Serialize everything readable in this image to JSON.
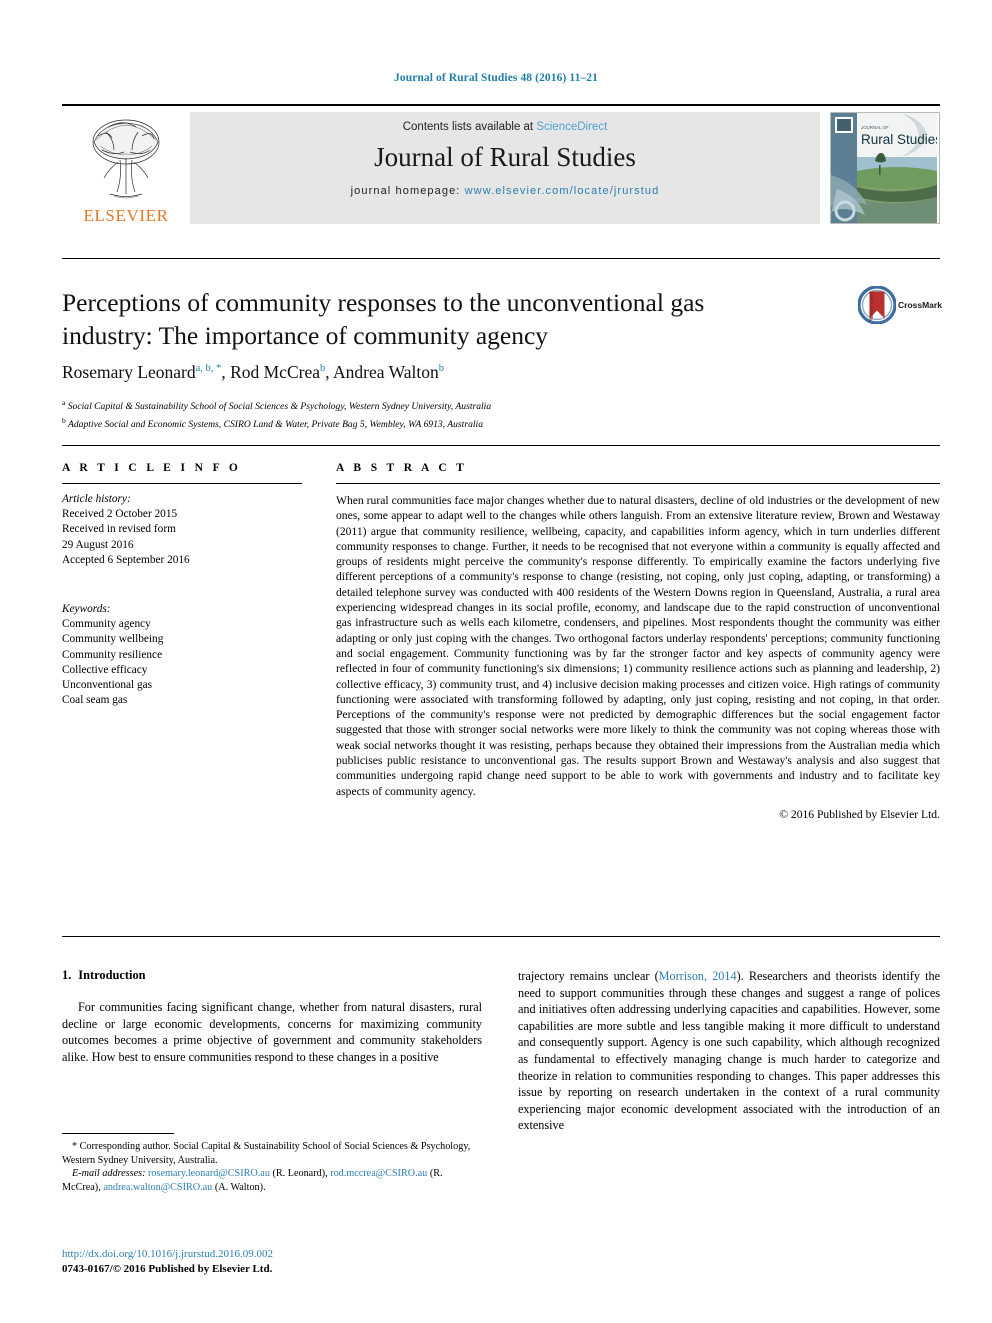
{
  "running_head": "Journal of Rural Studies 48 (2016) 11–21",
  "masthead": {
    "publisher": "ELSEVIER",
    "contents_prefix": "Contents lists available at",
    "contents_link": "ScienceDirect",
    "journal_title": "Journal of Rural Studies",
    "homepage_prefix": "journal homepage:",
    "homepage_url": "www.elsevier.com/locate/jrurstud",
    "cover_kicker": "JOURNAL OF",
    "cover_title": "Rural Studies"
  },
  "article": {
    "title": "Perceptions of community responses to the unconventional gas industry: The importance of community agency",
    "crossmark_label": "CrossMark",
    "authors": [
      {
        "name": "Rosemary Leonard",
        "marks": "a, b, *"
      },
      {
        "name": "Rod McCrea",
        "marks": "b"
      },
      {
        "name": "Andrea Walton",
        "marks": "b"
      }
    ],
    "affiliations": [
      {
        "mark": "a",
        "text": "Social Capital & Sustainability School of Social Sciences & Psychology, Western Sydney University, Australia"
      },
      {
        "mark": "b",
        "text": "Adaptive Social and Economic Systems, CSIRO Land & Water, Private Bag 5, Wembley, WA 6913, Australia"
      }
    ]
  },
  "info": {
    "heading": "A R T I C L E   I N F O",
    "history_label": "Article history:",
    "history": [
      "Received 2 October 2015",
      "Received in revised form",
      "29 August 2016",
      "Accepted 6 September 2016"
    ],
    "keywords_label": "Keywords:",
    "keywords": [
      "Community agency",
      "Community wellbeing",
      "Community resilience",
      "Collective efficacy",
      "Unconventional gas",
      "Coal seam gas"
    ]
  },
  "abstract": {
    "heading": "A B S T R A C T",
    "text": "When rural communities face major changes whether due to natural disasters, decline of old industries or the development of new ones, some appear to adapt well to the changes while others languish. From an extensive literature review, Brown and Westaway (2011) argue that community resilience, wellbeing, capacity, and capabilities inform agency, which in turn underlies different community responses to change. Further, it needs to be recognised that not everyone within a community is equally affected and groups of residents might perceive the community's response differently. To empirically examine the factors underlying five different perceptions of a community's response to change (resisting, not coping, only just coping, adapting, or transforming) a detailed telephone survey was conducted with 400 residents of the Western Downs region in Queensland, Australia, a rural area experiencing widespread changes in its social profile, economy, and landscape due to the rapid construction of unconventional gas infrastructure such as wells each kilometre, condensers, and pipelines. Most respondents thought the community was either adapting or only just coping with the changes. Two orthogonal factors underlay respondents' perceptions; community functioning and social engagement. Community functioning was by far the stronger factor and key aspects of community agency were reflected in four of community functioning's six dimensions; 1) community resilience actions such as planning and leadership, 2) collective efficacy, 3) community trust, and 4) inclusive decision making processes and citizen voice. High ratings of community functioning were associated with transforming followed by adapting, only just coping, resisting and not coping, in that order. Perceptions of the community's response were not predicted by demographic differences but the social engagement factor suggested that those with stronger social networks were more likely to think the community was not coping whereas those with weak social networks thought it was resisting, perhaps because they obtained their impressions from the Australian media which publicises public resistance to unconventional gas. The results support Brown and Westaway's analysis and also suggest that communities undergoing rapid change need support to be able to work with governments and industry and to facilitate key aspects of community agency.",
    "copyright": "© 2016 Published by Elsevier Ltd."
  },
  "introduction": {
    "number": "1.",
    "heading": "Introduction",
    "left_paragraph_part1": "For communities facing significant change, whether from natural disasters, rural decline or large economic developments, concerns for maximizing community outcomes becomes a prime objective of government and community stakeholders alike. How best to ensure communities respond to these changes in a positive",
    "right_part_before_cite": "trajectory remains unclear (",
    "right_citation": "Morrison, 2014",
    "right_part_after_cite": "). Researchers and theorists identify the need to support communities through these changes and suggest a range of polices and initiatives often addressing underlying capacities and capabilities. However, some capabilities are more subtle and less tangible making it more difficult to understand and consequently support. Agency is one such capability, which although recognized as fundamental to effectively managing change is much harder to categorize and theorize in relation to communities responding to changes. This paper addresses this issue by reporting on research undertaken in the context of a rural community experiencing major economic development associated with the introduction of an extensive"
  },
  "footnotes": {
    "corresponding": "* Corresponding author. Social Capital & Sustainability School of Social Sciences & Psychology, Western Sydney University, Australia.",
    "email_label": "E-mail addresses:",
    "emails": [
      {
        "address": "rosemary.leonard@CSIRO.au",
        "owner": "(R. Leonard)"
      },
      {
        "address": "rod.mccrea@CSIRO.au",
        "owner": "(R. McCrea)"
      },
      {
        "address": "andrea.walton@CSIRO.au",
        "owner": "(A. Walton)"
      }
    ],
    "doi": "http://dx.doi.org/10.1016/j.jrurstud.2016.09.002",
    "issn_line": "0743-0167/© 2016 Published by Elsevier Ltd."
  },
  "colors": {
    "link": "#2c7fb0",
    "running_head": "#1f7fa8",
    "elsevier_orange": "#e87722",
    "contents_bg": "#e6e6e6"
  }
}
